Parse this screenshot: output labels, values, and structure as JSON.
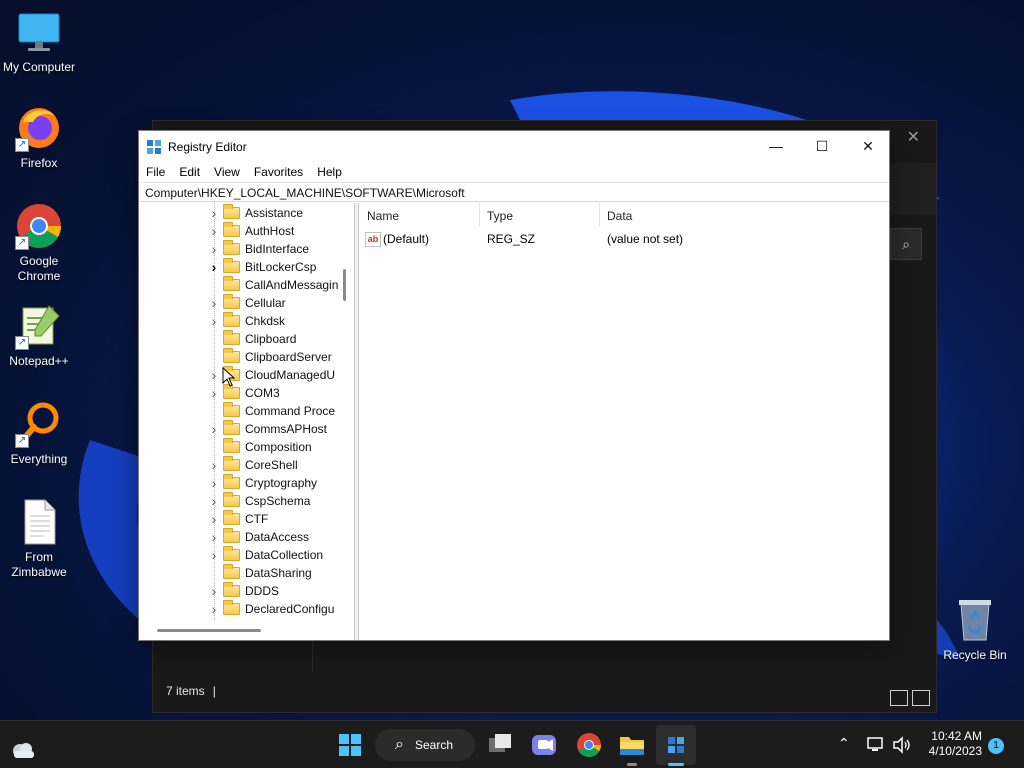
{
  "desktop": {
    "icons": [
      {
        "label": "My Computer",
        "icon": "monitor-icon"
      },
      {
        "label": "Firefox",
        "icon": "firefox-icon"
      },
      {
        "label": "Google Chrome",
        "icon": "chrome-icon"
      },
      {
        "label": "Notepad++",
        "icon": "notepadpp-icon"
      },
      {
        "label": "Everything",
        "icon": "everything-search-icon"
      },
      {
        "label": "From Zimbabwe",
        "icon": "document-icon"
      },
      {
        "label": "Recycle Bin",
        "icon": "recycle-bin-icon"
      }
    ]
  },
  "background_window": {
    "status": "7 items"
  },
  "regedit": {
    "title": "Registry Editor",
    "menu": [
      "File",
      "Edit",
      "View",
      "Favorites",
      "Help"
    ],
    "address": "Computer\\HKEY_LOCAL_MACHINE\\SOFTWARE\\Microsoft",
    "tree": [
      {
        "label": "Assistance",
        "expander": "chevron"
      },
      {
        "label": "AuthHost",
        "expander": "chevron"
      },
      {
        "label": "BidInterface",
        "expander": "chevron"
      },
      {
        "label": "BitLockerCsp",
        "expander": "chevron-dark"
      },
      {
        "label": "CallAndMessagin",
        "expander": "none"
      },
      {
        "label": "Cellular",
        "expander": "chevron"
      },
      {
        "label": "Chkdsk",
        "expander": "chevron"
      },
      {
        "label": "Clipboard",
        "expander": "none"
      },
      {
        "label": "ClipboardServer",
        "expander": "none"
      },
      {
        "label": "CloudManagedU",
        "expander": "chevron"
      },
      {
        "label": "COM3",
        "expander": "chevron"
      },
      {
        "label": "Command Proce",
        "expander": "none"
      },
      {
        "label": "CommsAPHost",
        "expander": "chevron"
      },
      {
        "label": "Composition",
        "expander": "none"
      },
      {
        "label": "CoreShell",
        "expander": "chevron"
      },
      {
        "label": "Cryptography",
        "expander": "chevron"
      },
      {
        "label": "CspSchema",
        "expander": "chevron"
      },
      {
        "label": "CTF",
        "expander": "chevron"
      },
      {
        "label": "DataAccess",
        "expander": "chevron"
      },
      {
        "label": "DataCollection",
        "expander": "chevron"
      },
      {
        "label": "DataSharing",
        "expander": "none"
      },
      {
        "label": "DDDS",
        "expander": "chevron"
      },
      {
        "label": "DeclaredConfigu",
        "expander": "chevron"
      }
    ],
    "columns": {
      "name": "Name",
      "type": "Type",
      "data": "Data"
    },
    "values": [
      {
        "name": "(Default)",
        "type": "REG_SZ",
        "data": "(value not set)"
      }
    ]
  },
  "taskbar": {
    "search_label": "Search",
    "time": "10:42 AM",
    "date": "4/10/2023",
    "notification_count": "1",
    "accent": "#4cc2ff"
  }
}
